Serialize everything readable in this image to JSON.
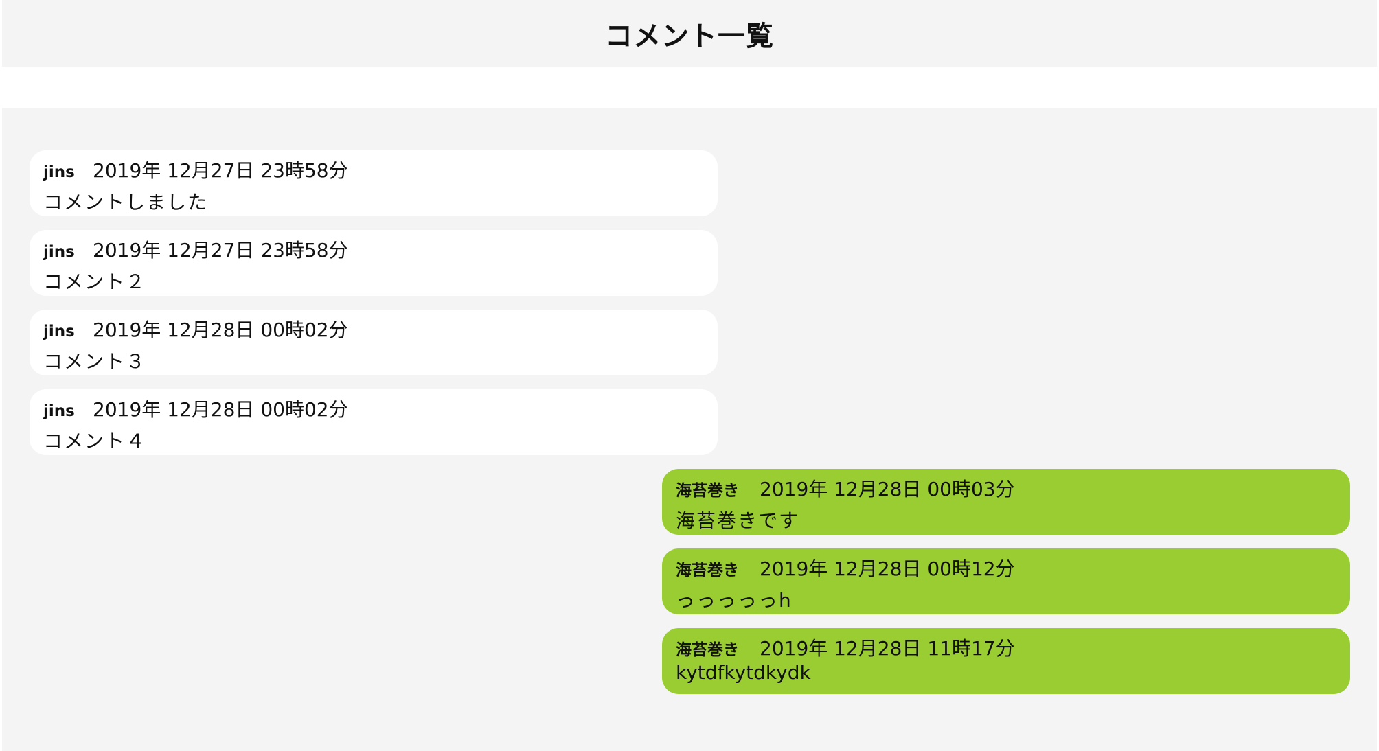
{
  "header": {
    "title": "コメント一覧"
  },
  "comments": [
    {
      "author": "jins",
      "date": "2019年 12月27日 23時58分",
      "text": "コメントしました",
      "side": "left"
    },
    {
      "author": "jins",
      "date": "2019年 12月27日 23時58分",
      "text": "コメント２",
      "side": "left"
    },
    {
      "author": "jins",
      "date": "2019年 12月28日 00時02分",
      "text": "コメント３",
      "side": "left"
    },
    {
      "author": "jins",
      "date": "2019年 12月28日 00時02分",
      "text": "コメント４",
      "side": "left"
    },
    {
      "author": "海苔巻き",
      "date": "2019年 12月28日 00時03分",
      "text": "海苔巻きです",
      "side": "right"
    },
    {
      "author": "海苔巻き",
      "date": "2019年 12月28日 00時12分",
      "text": "っっっっっh",
      "side": "right"
    },
    {
      "author": "海苔巻き",
      "date": "2019年 12月28日 11時17分",
      "text": "kytdfkytdkydk",
      "side": "right"
    }
  ],
  "colors": {
    "own_bubble": "#9acd32",
    "other_bubble": "#ffffff",
    "background": "#f4f4f4"
  }
}
